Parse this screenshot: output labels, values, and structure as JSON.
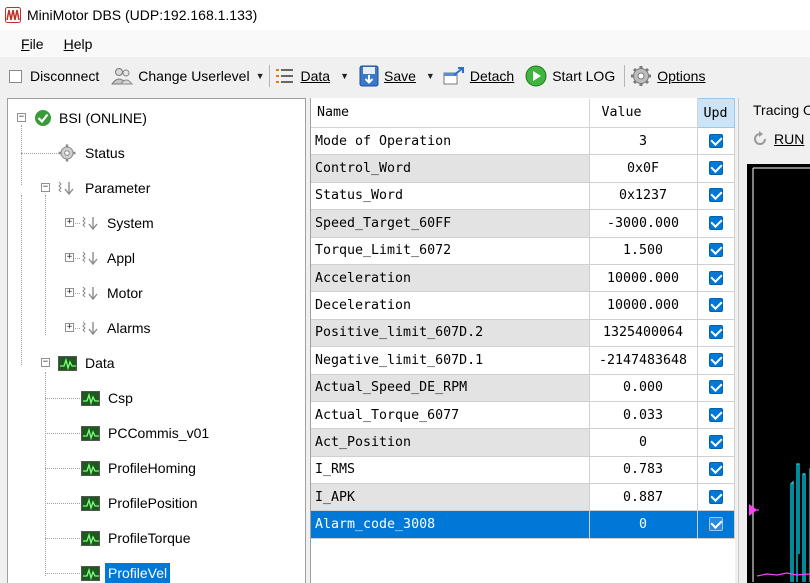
{
  "window": {
    "title": "MiniMotor DBS (UDP:192.168.1.133)"
  },
  "menu": [
    {
      "label": "File",
      "mnemonic": "F",
      "rest": "ile"
    },
    {
      "label": "Help",
      "mnemonic": "H",
      "rest": "elp"
    }
  ],
  "toolbar": {
    "disconnect": "Disconnect",
    "change_userlevel": "Change Userlevel",
    "data": "Data",
    "save": "Save",
    "detach": "Detach",
    "start_log": "Start LOG",
    "options": "Options"
  },
  "tree": {
    "root": "BSI (ONLINE)",
    "status": "Status",
    "parameter": "Parameter",
    "parameter_children": [
      "System",
      "Appl",
      "Motor",
      "Alarms"
    ],
    "data": "Data",
    "data_children": [
      "Csp",
      "PCCommis_v01",
      "ProfileHoming",
      "ProfilePosition",
      "ProfileTorque",
      "ProfileVel"
    ],
    "selected": "ProfileVel"
  },
  "grid": {
    "headers": {
      "name": "Name",
      "value": "Value",
      "upd": "Upd"
    },
    "rows": [
      {
        "name": "Mode of Operation",
        "value": "3",
        "upd": true
      },
      {
        "name": "Control_Word",
        "value": "0x0F",
        "upd": true
      },
      {
        "name": "Status_Word",
        "value": "0x1237",
        "upd": true
      },
      {
        "name": "Speed_Target_60FF",
        "value": "-3000.000",
        "upd": true
      },
      {
        "name": "Torque_Limit_6072",
        "value": "1.500",
        "upd": true
      },
      {
        "name": "Acceleration",
        "value": "10000.000",
        "upd": true
      },
      {
        "name": "Deceleration",
        "value": "10000.000",
        "upd": true
      },
      {
        "name": "Positive_limit_607D.2",
        "value": "1325400064",
        "upd": true
      },
      {
        "name": "Negative_limit_607D.1",
        "value": "-2147483648",
        "upd": true
      },
      {
        "name": "Actual_Speed_DE_RPM",
        "value": "0.000",
        "upd": true
      },
      {
        "name": "Actual_Torque_6077",
        "value": "0.033",
        "upd": true
      },
      {
        "name": "Act_Position",
        "value": "0",
        "upd": true
      },
      {
        "name": "I_RMS",
        "value": "0.783",
        "upd": true
      },
      {
        "name": "I_APK",
        "value": "0.887",
        "upd": true
      },
      {
        "name": "Alarm_code_3008",
        "value": "0",
        "upd": true,
        "selected": true
      }
    ]
  },
  "tracing": {
    "title": "Tracing O",
    "run": "RUN"
  },
  "colors": {
    "accent": "#0078d7",
    "scope_bg": "#000000",
    "trace_cyan": "#00e5ff",
    "trace_magenta": "#ff40ff"
  }
}
